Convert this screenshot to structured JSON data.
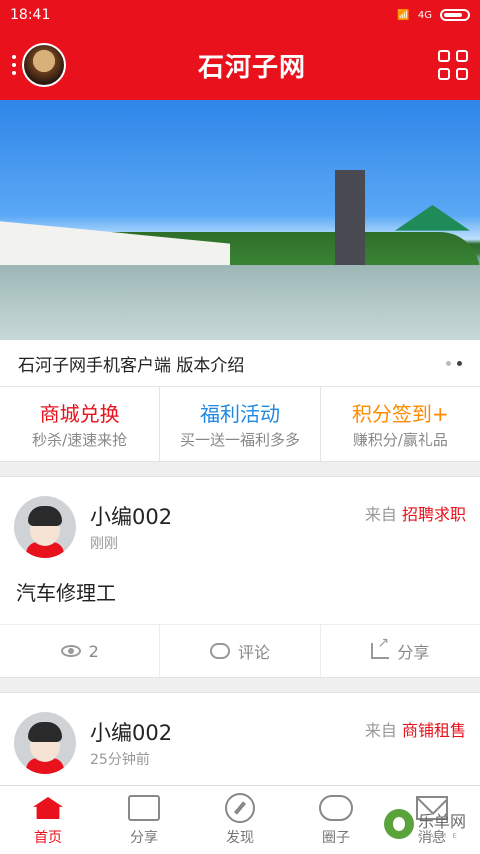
{
  "status": {
    "time": "18:41",
    "network": "4G",
    "colors": {
      "primary": "#e8111c"
    }
  },
  "header": {
    "title": "石河子网",
    "menu_icon": "more-icon",
    "grid_icon": "grid-icon"
  },
  "banner": {
    "caption": "石河子网手机客户端 版本介绍"
  },
  "features": [
    {
      "title": "商城兑换",
      "subtitle": "秒杀/速速来抢",
      "color": "#e8111c"
    },
    {
      "title": "福利活动",
      "subtitle": "买一送一福利多多",
      "color": "#1e88e5"
    },
    {
      "title": "积分签到+",
      "subtitle": "赚积分/赢礼品",
      "color": "#ff8a00"
    }
  ],
  "posts": [
    {
      "name": "小编002",
      "time": "刚刚",
      "from_label": "来自",
      "category": "招聘求职",
      "content": "汽车修理工",
      "views": "2",
      "comment_label": "评论",
      "share_label": "分享"
    },
    {
      "name": "小编002",
      "time": "25分钟前",
      "from_label": "来自",
      "category": "商铺租售"
    }
  ],
  "tabs": [
    {
      "label": "首页",
      "icon": "home-icon",
      "active": true
    },
    {
      "label": "分享",
      "icon": "image-icon",
      "active": false
    },
    {
      "label": "发现",
      "icon": "compass-icon",
      "active": false
    },
    {
      "label": "圈子",
      "icon": "chat-icon",
      "active": false
    },
    {
      "label": "消息",
      "icon": "mail-icon",
      "active": false
    }
  ],
  "watermark": {
    "text": "乐单网",
    "sub": "C A M E"
  }
}
